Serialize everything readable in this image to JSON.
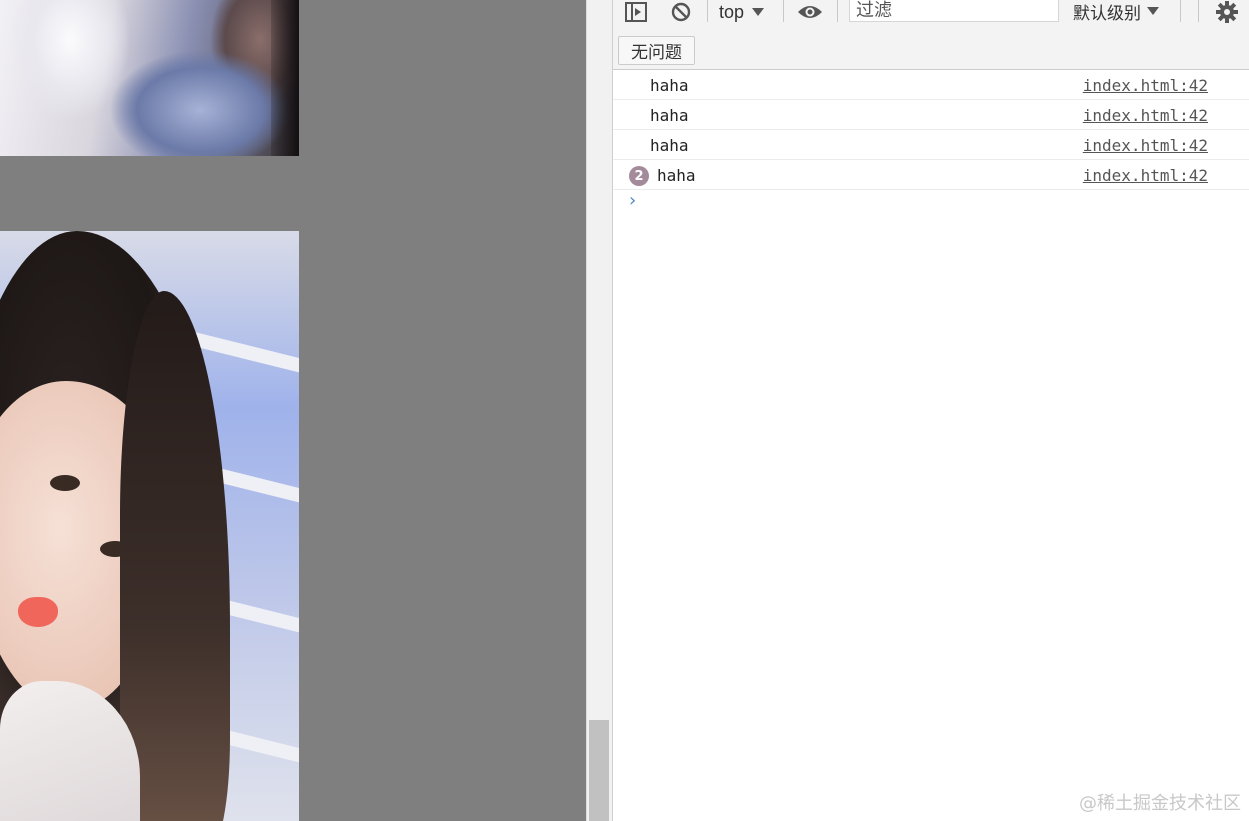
{
  "page": {
    "images": [
      {
        "name": "blurred-photo"
      },
      {
        "name": "portrait-photo"
      }
    ]
  },
  "devtools": {
    "toolbar": {
      "sidebar_icon": "sidebar-toggle-icon",
      "clear_icon": "clear-console-icon",
      "context": "top",
      "eye_icon": "live-expression-icon",
      "filter_placeholder": "过滤",
      "levels": "默认级别",
      "settings_icon": "gear-icon"
    },
    "issues_button": "无问题",
    "messages": [
      {
        "text": "haha",
        "source": "index.html:42"
      },
      {
        "text": "haha",
        "source": "index.html:42"
      },
      {
        "text": "haha",
        "source": "index.html:42"
      },
      {
        "text": "haha",
        "source": "index.html:42",
        "count": "2"
      }
    ],
    "prompt_symbol": "›"
  },
  "watermark": "@稀土掘金技术社区",
  "colors": {
    "page_background": "#7f7f7f",
    "toolbar_background": "#f3f3f3",
    "badge": "#a48b9c",
    "prompt": "#4f86c6"
  }
}
